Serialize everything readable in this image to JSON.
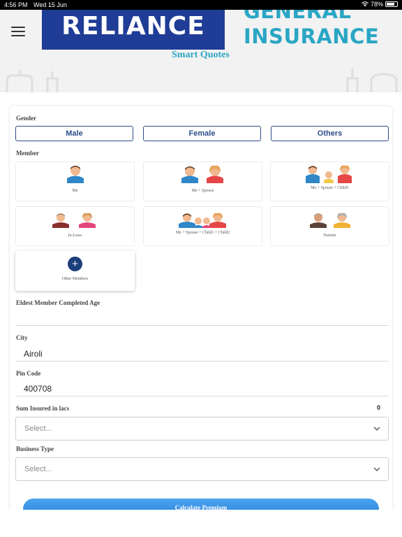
{
  "status_bar": {
    "time": "4:56 PM",
    "date": "Wed 15 Jun",
    "battery": "78%",
    "battery_level": 0.78
  },
  "header": {
    "reliance_logo": "RELIANCE",
    "gi_line1": "GENERAL",
    "gi_line2": "INSURANCE",
    "subtitle": "Smart Quotes"
  },
  "gender": {
    "label": "Gender",
    "options": [
      "Male",
      "Female",
      "Others"
    ]
  },
  "member": {
    "label": "Member",
    "options": [
      "Me",
      "Me + Spouse",
      "Me + Spouse + Child1",
      "In-Laws",
      "Me + Spouse + Child1 + Child2",
      "Parents"
    ],
    "other_label": "Other Members",
    "plus": "+"
  },
  "eldest": {
    "label": "Eldest Member Completed Age",
    "value": ""
  },
  "city": {
    "label": "City",
    "value": "Airoli"
  },
  "pincode": {
    "label": "Pin Code",
    "value": "400708"
  },
  "sum_insured": {
    "label": "Sum Insured in lacs",
    "value": "0",
    "placeholder": "Select..."
  },
  "business_type": {
    "label": "Business Type",
    "placeholder": "Select..."
  },
  "calculate_button": "Calculate Premium",
  "colors": {
    "brand_blue": "#1f3c96",
    "accent_teal": "#2aa6c4",
    "button_blue": "#2a7fd8",
    "outline_blue": "#2d4e8a"
  }
}
